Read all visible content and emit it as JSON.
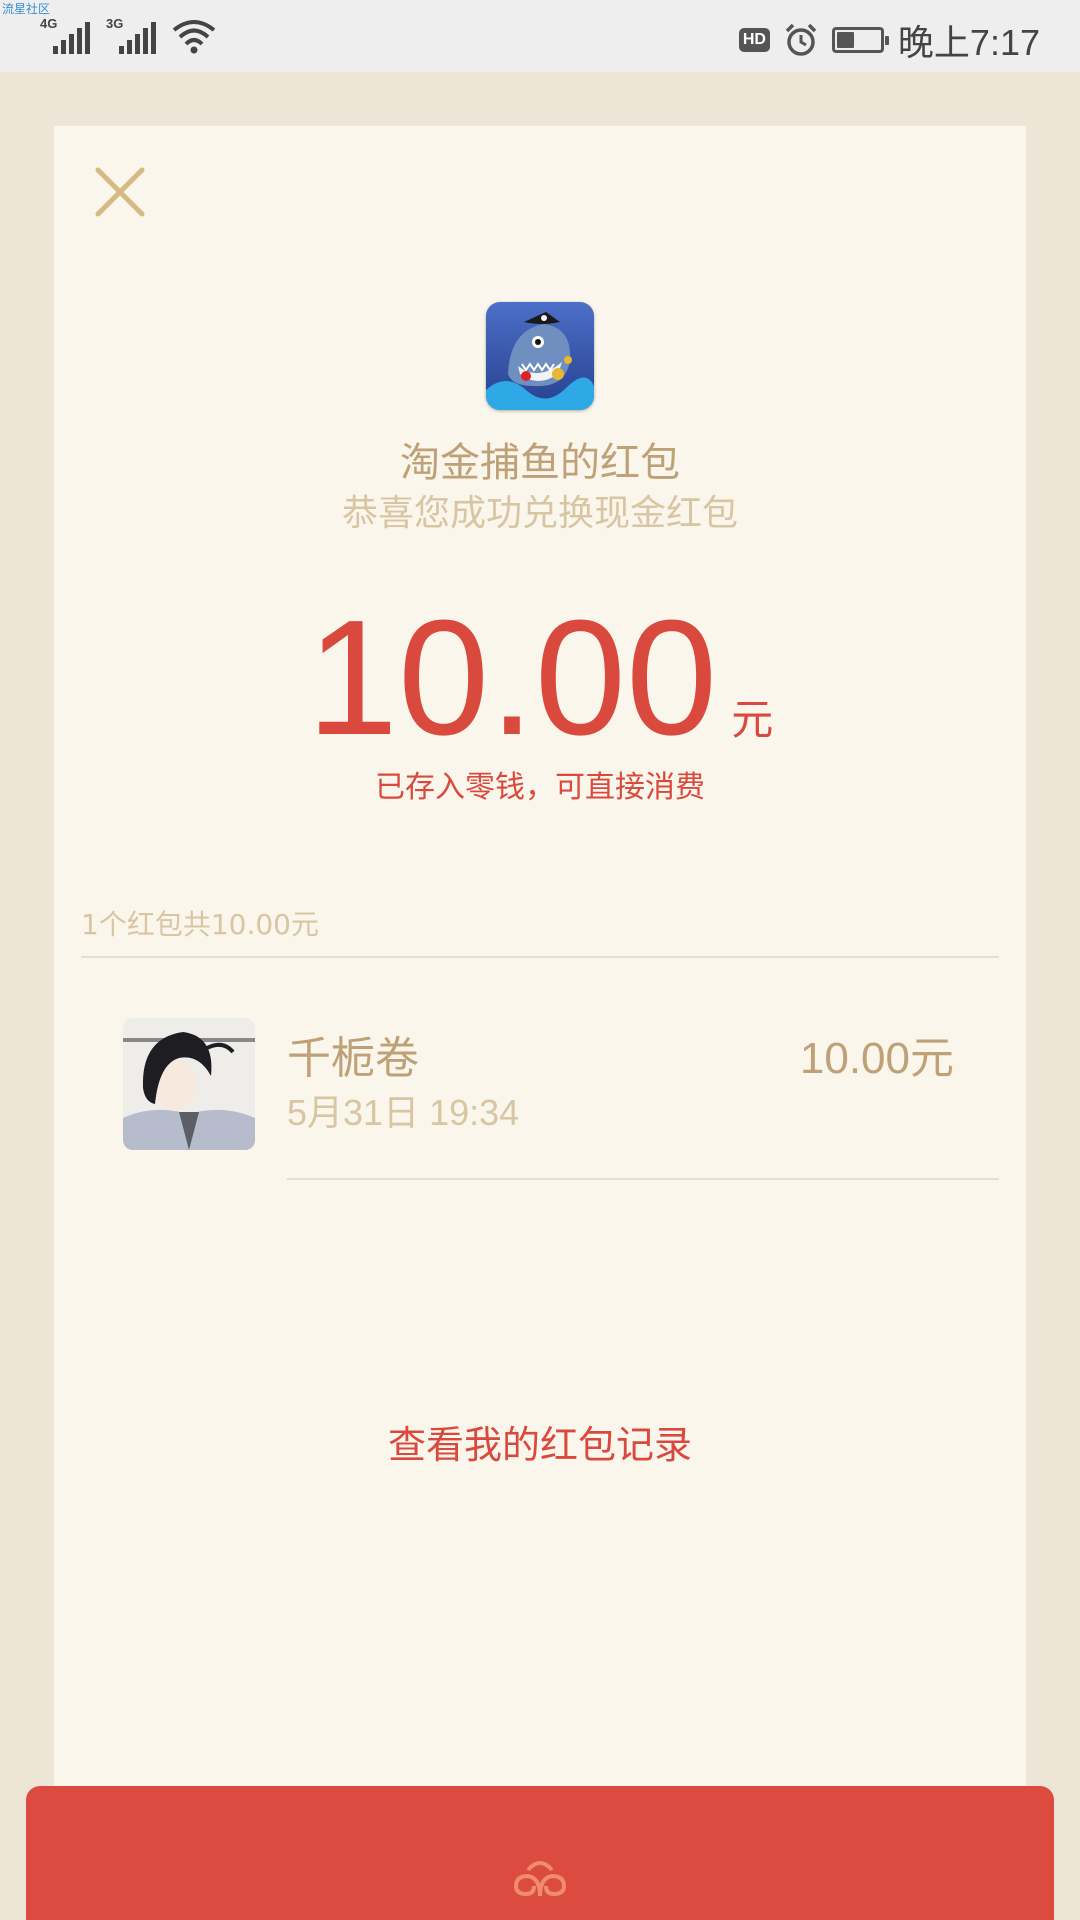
{
  "status_bar": {
    "watermark": "流星社区",
    "network1": "4G",
    "network2": "3G",
    "hd_badge": "HD",
    "battery_level": 0.4,
    "time": "晚上7:17"
  },
  "card": {
    "app_name": "淘金捕鱼的红包",
    "subtitle": "恭喜您成功兑换现金红包",
    "amount": "10.00",
    "amount_unit": "元",
    "note": "已存入零钱，可直接消费",
    "summary": "1个红包共10.00元",
    "records": [
      {
        "name": "千栀卷",
        "time": "5月31日  19:34",
        "amount": "10.00元"
      }
    ],
    "view_records_label": "查看我的红包记录"
  },
  "icons": [
    "close-icon",
    "app-icon",
    "avatar",
    "envelope-logo-icon"
  ],
  "colors": {
    "accent_red": "#D9493D",
    "gold": "#BFA177",
    "light_gold": "#D8C5A2",
    "card_bg": "#FAF6EC",
    "page_bg": "#EDE6D6"
  }
}
